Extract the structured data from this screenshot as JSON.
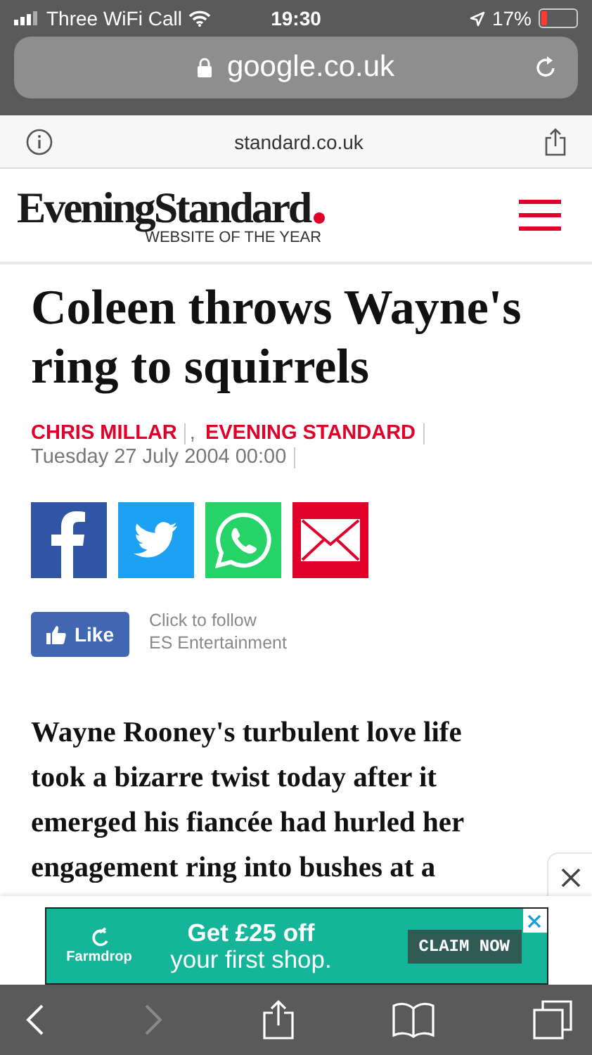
{
  "status_bar": {
    "carrier": "Three WiFi Call",
    "time": "19:30",
    "battery": "17%"
  },
  "address_bar": {
    "url": "google.co.uk"
  },
  "site_bar": {
    "domain": "standard.co.uk"
  },
  "header": {
    "logo": "EveningStandard",
    "tagline": "WEBSITE OF THE YEAR"
  },
  "article": {
    "headline": "Coleen throws Wayne's ring to squirrels",
    "byline": {
      "author": "CHRIS MILLAR",
      "separator": ",",
      "publication": "EVENING STANDARD",
      "date": "Tuesday 27 July 2004 00:00"
    },
    "share_buttons": [
      {
        "kind": "facebook"
      },
      {
        "kind": "twitter"
      },
      {
        "kind": "whatsapp"
      },
      {
        "kind": "email"
      }
    ],
    "like": {
      "label": "Like",
      "follow_line_1": "Click to follow",
      "follow_line_2": "ES Entertainment"
    },
    "body": "Wayne Rooney's turbulent love life took a bizarre twist today after it emerged his fiancée had hurled her engagement ring into bushes at a"
  },
  "ad": {
    "brand": "Farmdrop",
    "headline": "Get £25 off",
    "subline": "your first shop.",
    "cta": "CLAIM NOW"
  },
  "toolbar": [
    {
      "kind": "back",
      "disabled": false
    },
    {
      "kind": "forward",
      "disabled": true
    },
    {
      "kind": "share",
      "disabled": false
    },
    {
      "kind": "bookmarks",
      "disabled": false
    },
    {
      "kind": "tabs",
      "disabled": false
    }
  ]
}
